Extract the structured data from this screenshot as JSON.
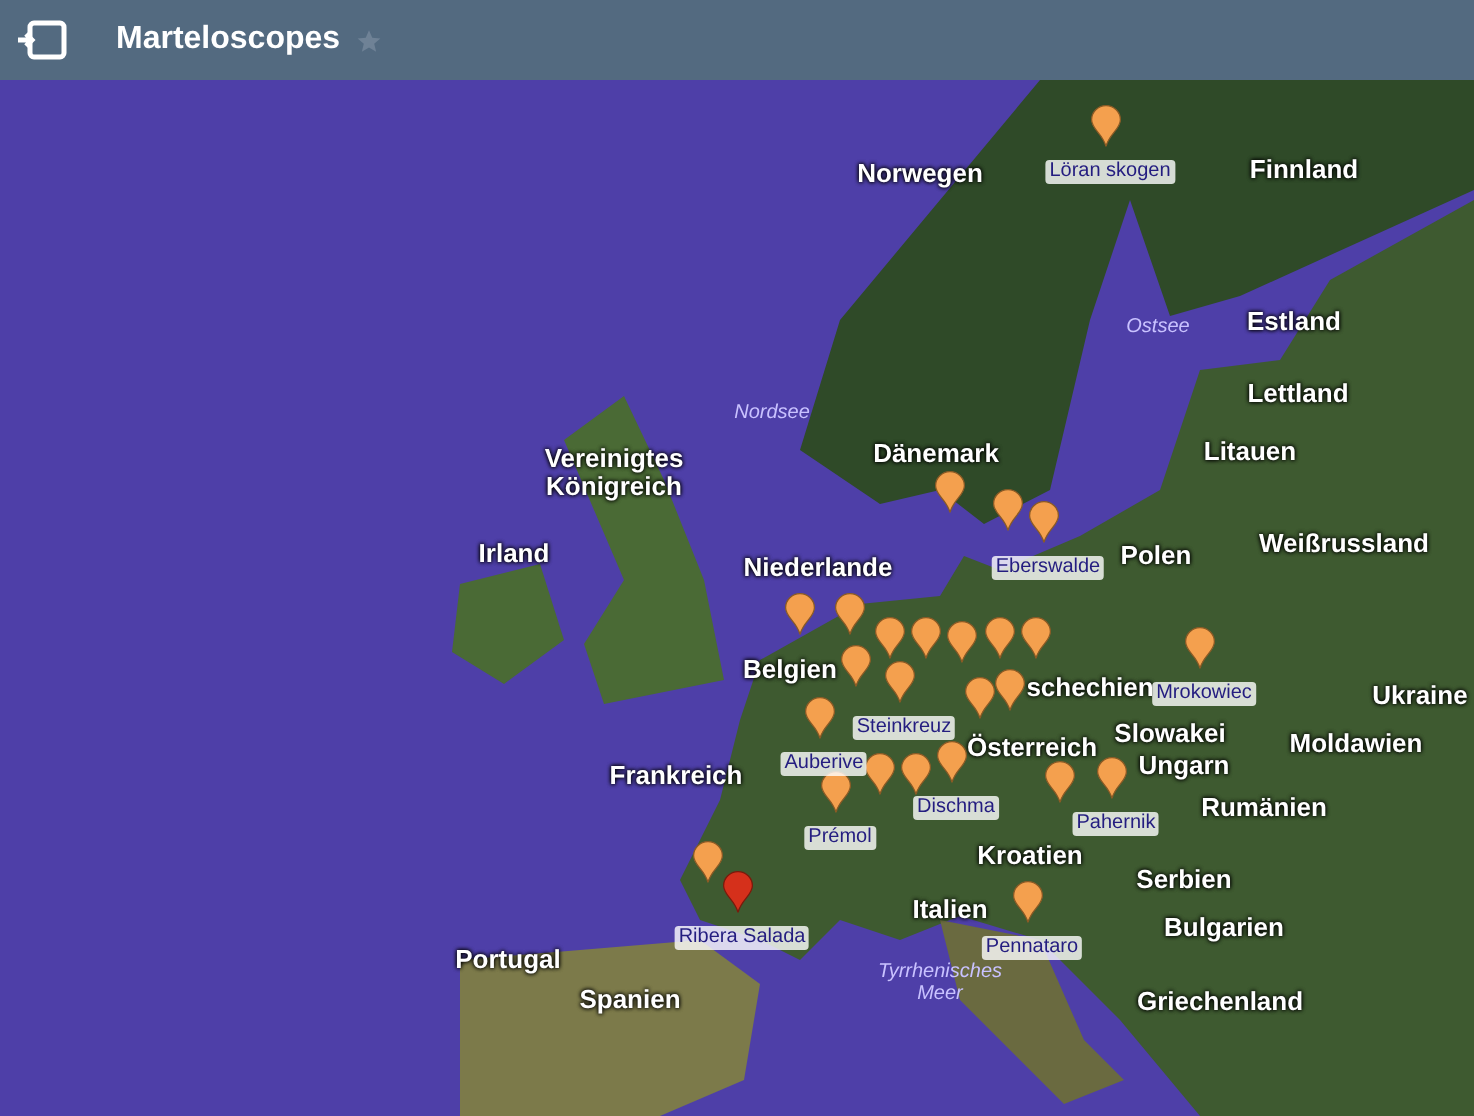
{
  "header": {
    "title": "Marteloscopes",
    "favorite": false
  },
  "map": {
    "labels": [
      {
        "text": "Norwegen",
        "kind": "country"
      },
      {
        "text": "Finnland",
        "kind": "country"
      },
      {
        "text": "Estland",
        "kind": "country"
      },
      {
        "text": "Lettland",
        "kind": "country"
      },
      {
        "text": "Litauen",
        "kind": "country"
      },
      {
        "text": "Nordsee",
        "kind": "sea"
      },
      {
        "text": "Ostsee",
        "kind": "sea"
      },
      {
        "text": "Vereinigtes Königreich",
        "kind": "country"
      },
      {
        "text": "Dänemark",
        "kind": "country"
      },
      {
        "text": "Irland",
        "kind": "country"
      },
      {
        "text": "Polen",
        "kind": "country"
      },
      {
        "text": "Weißrussland",
        "kind": "country"
      },
      {
        "text": "Niederlande",
        "kind": "country"
      },
      {
        "text": "Belgien",
        "kind": "country"
      },
      {
        "text": "schechien",
        "kind": "country"
      },
      {
        "text": "Slowakei",
        "kind": "country"
      },
      {
        "text": "Ukraine",
        "kind": "country"
      },
      {
        "text": "Moldawien",
        "kind": "country"
      },
      {
        "text": "Frankreich",
        "kind": "country"
      },
      {
        "text": "Österreich",
        "kind": "country"
      },
      {
        "text": "Ungarn",
        "kind": "country"
      },
      {
        "text": "Rumänien",
        "kind": "country"
      },
      {
        "text": "Kroatien",
        "kind": "country"
      },
      {
        "text": "Serbien",
        "kind": "country"
      },
      {
        "text": "Italien",
        "kind": "country"
      },
      {
        "text": "Bulgarien",
        "kind": "country"
      },
      {
        "text": "Portugal",
        "kind": "country"
      },
      {
        "text": "Spanien",
        "kind": "country"
      },
      {
        "text": "Tyrrhenisches Meer",
        "kind": "sea"
      },
      {
        "text": "Griechenland",
        "kind": "country"
      }
    ],
    "pins": [
      {
        "label": "Löran skogen",
        "selected": false
      },
      {
        "selected": false
      },
      {
        "selected": false
      },
      {
        "label": "Eberswalde",
        "selected": false
      },
      {
        "selected": false
      },
      {
        "selected": false
      },
      {
        "selected": false
      },
      {
        "selected": false
      },
      {
        "selected": false
      },
      {
        "selected": false
      },
      {
        "label": "Steinkreuz",
        "selected": false
      },
      {
        "selected": false
      },
      {
        "selected": false
      },
      {
        "selected": false
      },
      {
        "label": "Auberive",
        "selected": false
      },
      {
        "selected": false
      },
      {
        "selected": false
      },
      {
        "label": "Dischma",
        "selected": false
      },
      {
        "selected": false
      },
      {
        "label": "Mrokowiec",
        "selected": false
      },
      {
        "selected": false
      },
      {
        "label": "Pahernik",
        "selected": false
      },
      {
        "label": "Prémol",
        "selected": false
      },
      {
        "selected": false
      },
      {
        "label": "Ribera Salada",
        "selected": true
      },
      {
        "label": "Pennataro",
        "selected": false
      }
    ]
  }
}
